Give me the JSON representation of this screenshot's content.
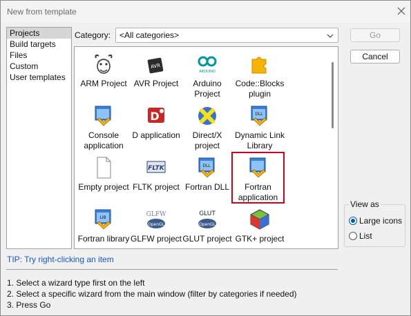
{
  "window": {
    "title": "New from template"
  },
  "categories_list": {
    "items": [
      "Projects",
      "Build targets",
      "Files",
      "Custom",
      "User templates"
    ],
    "selected": "Projects"
  },
  "category": {
    "label": "Category:",
    "value": "<All categories>"
  },
  "templates": [
    {
      "label": "ARM Project",
      "icon": "gnu-gnu-icon"
    },
    {
      "label": "AVR Project",
      "icon": "avr-chip-icon"
    },
    {
      "label": "Arduino Project",
      "icon": "arduino-icon"
    },
    {
      "label": "Code::Blocks plugin",
      "icon": "puzzle-plugin-icon"
    },
    {
      "label": "Console application",
      "icon": "console-app-icon"
    },
    {
      "label": "D application",
      "icon": "d-logo-icon"
    },
    {
      "label": "Direct/X project",
      "icon": "directx-icon"
    },
    {
      "label": "Dynamic Link Library",
      "icon": "dll-icon"
    },
    {
      "label": "Empty project",
      "icon": "empty-file-icon"
    },
    {
      "label": "FLTK project",
      "icon": "fltk-icon"
    },
    {
      "label": "Fortran DLL",
      "icon": "fortran-dll-icon"
    },
    {
      "label": "Fortran application",
      "icon": "fortran-app-icon"
    },
    {
      "label": "Fortran library",
      "icon": "fortran-lib-icon"
    },
    {
      "label": "GLFW project",
      "icon": "glfw-icon"
    },
    {
      "label": "GLUT project",
      "icon": "glut-icon"
    },
    {
      "label": "GTK+ project",
      "icon": "gtk-icon"
    }
  ],
  "buttons": {
    "go": "Go",
    "cancel": "Cancel"
  },
  "view_as": {
    "legend": "View as",
    "large_icons": "Large icons",
    "list": "List",
    "selected": "Large icons"
  },
  "tip": "TIP: Try right-clicking an item",
  "instructions": [
    "1. Select a wizard type first on the left",
    "2. Select a specific wizard from the main window (filter by categories if needed)",
    "3. Press Go"
  ],
  "colors": {
    "selection_outline": "#d0001b",
    "tip_text": "#1a55c8",
    "radio_accent": "#0058c4"
  }
}
